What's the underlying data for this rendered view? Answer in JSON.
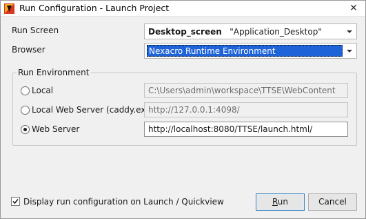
{
  "window": {
    "title": "Run Configuration - Launch Project",
    "close_glyph": "✕",
    "icon": "nexacro-app-icon"
  },
  "run_screen": {
    "label": "Run Screen",
    "value_bold": "Desktop_screen",
    "value_rest": "\"Application_Desktop\""
  },
  "browser": {
    "label": "Browser",
    "value": "Nexacro Runtime Environment"
  },
  "run_environment": {
    "title": "Run Environment",
    "options": [
      {
        "label": "Local",
        "path": "C:\\Users\\admin\\workspace\\TTSE\\WebContent",
        "selected": false
      },
      {
        "label": "Local Web Server (caddy.exe)",
        "path": "http://127.0.0.1:4098/",
        "selected": false
      },
      {
        "label": "Web Server",
        "path": "http://localhost:8080/TTSE/launch.html/",
        "selected": true
      }
    ]
  },
  "footer": {
    "checkbox_label": "Display run configuration on Launch / Quickview",
    "checkbox_checked": true,
    "run_mnemonic": "R",
    "run_rest": "un",
    "cancel_label": "Cancel"
  },
  "colors": {
    "accent": "#1e63d8",
    "window_bg": "#f0f0f0",
    "default_button_border": "#3c7fb1"
  }
}
